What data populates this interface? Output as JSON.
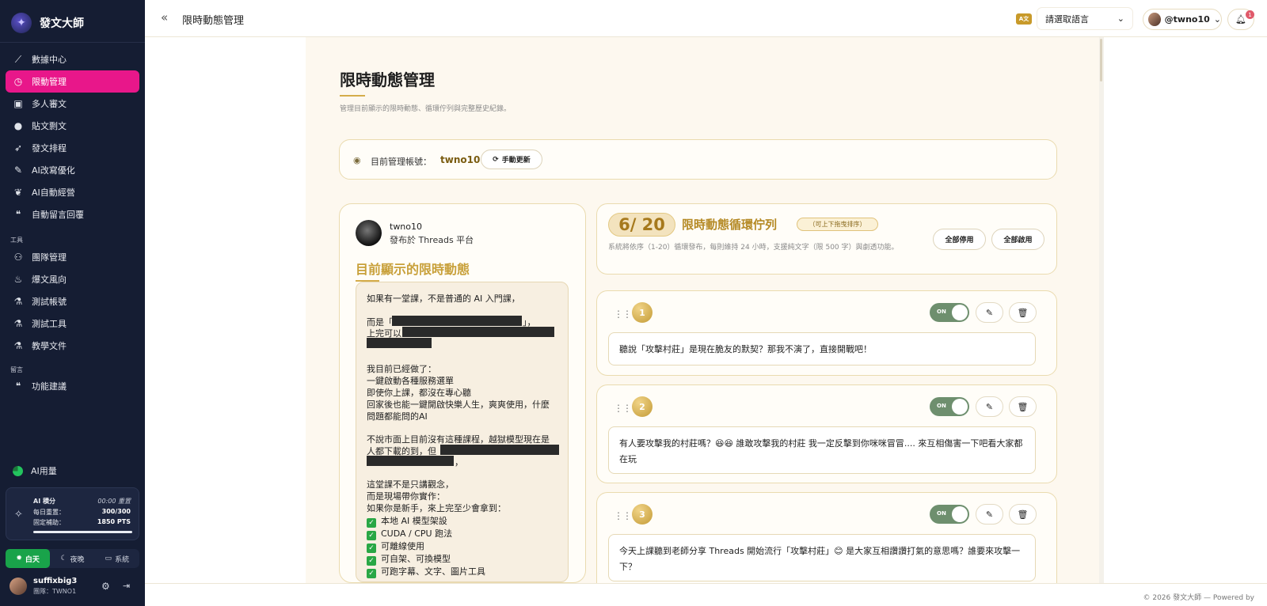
{
  "app": {
    "name": "發文大師"
  },
  "sidebar": {
    "items": [
      {
        "label": "數據中心",
        "icon": "chart-line-icon"
      },
      {
        "label": "限動管理",
        "icon": "clock-icon",
        "active": true
      },
      {
        "label": "多人審文",
        "icon": "calendar-check-icon"
      },
      {
        "label": "貼文剽文",
        "icon": "user-icon"
      },
      {
        "label": "發文排程",
        "icon": "rocket-icon"
      },
      {
        "label": "AI改寫優化",
        "icon": "pen-icon"
      },
      {
        "label": "AI自動經營",
        "icon": "seedling-icon"
      },
      {
        "label": "自動留言回覆",
        "icon": "comments-icon"
      }
    ],
    "tools_label": "工具",
    "tools": [
      {
        "label": "團隊管理",
        "icon": "users-icon"
      },
      {
        "label": "爆文風向",
        "icon": "fire-icon"
      },
      {
        "label": "測試帳號",
        "icon": "flask-vial-icon"
      },
      {
        "label": "測試工具",
        "icon": "flask-icon"
      },
      {
        "label": "教學文件",
        "icon": "flask-vial-icon"
      }
    ],
    "comments_label": "留言",
    "comments": [
      {
        "label": "功能建議",
        "icon": "comments-icon"
      }
    ],
    "ai_usage_label": "AI用量",
    "points": {
      "title": "AI 積分",
      "reset": "00:00 重置",
      "daily_label": "每日重置：",
      "daily_value": "300/300",
      "fixed_label": "固定補助：",
      "fixed_value": "1850 PTS",
      "daily_fraction": 1.0
    },
    "theme": {
      "light": "白天",
      "dark": "夜晚",
      "system": "系統"
    },
    "user": {
      "name": "suffixbig3",
      "team": "團隊：TWNO1"
    }
  },
  "topbar": {
    "title": "限時動態管理",
    "lang_icon": "A文",
    "lang_select": "請選取語言",
    "account": "@twno10",
    "notifications": "1"
  },
  "page": {
    "title": "限時動態管理",
    "subtitle": "管理目前顯示的限時動態、循環佇列與完整歷史紀錄。",
    "account_label": "目前管理帳號：",
    "account_value": "twno10",
    "refresh_label": "手動更新"
  },
  "current_story": {
    "username": "twno10",
    "platform": "發布於 Threads 平台",
    "heading": "目前顯示的限時動態",
    "lines": [
      "如果有一堂課，不是普通的 AI 入門課，",
      "而是「",
      "」，",
      "上完可以",
      "我目前已經做了：",
      "一鍵啟動各種服務選單",
      "即使你上課，都沒在專心聽",
      "回家後也能一鍵開啟快樂人生，爽爽使用，什麼",
      "問題都能問的AI",
      "不說市面上目前沒有這種課程，越獄模型現在是",
      "人都下載的到，但",
      "，",
      "這堂課不是只講觀念，",
      "而是現場帶你實作：",
      "如果你是新手，來上完至少會拿到："
    ],
    "checklist": [
      "本地 AI 模型架設",
      "CUDA / CPU 跑法",
      "可離線使用",
      "可自架、可換模型",
      "可跑字幕、文字、圖片工具"
    ]
  },
  "queue": {
    "count": "6/ 20",
    "title": "限時動態循環佇列",
    "tag": "（可上下拖曳排序）",
    "description": "系統將依序（1-20）循環發布，每則維持 24 小時，支援純文字（限 500 字）與劇透功能。",
    "disable_all": "全部停用",
    "enable_all": "全部啟用",
    "items": [
      {
        "index": "1",
        "toggle": "ON",
        "text": "聽說「攻擊村莊」是現在脆友的默契？那我不演了，直接開戰吧！"
      },
      {
        "index": "2",
        "toggle": "ON",
        "text": "有人要攻擊我的村莊嗎？😆😆 誰敢攻擊我的村莊 我一定反擊到你咪咪冒冒.... 來互相傷害一下吧看大家都在玩"
      },
      {
        "index": "3",
        "toggle": "ON",
        "text": "今天上課聽到老師分享 Threads 開始流行「攻擊村莊」😊 是大家互相讚讚打氣的意思嗎？誰要來攻擊一下？"
      }
    ]
  },
  "footer": {
    "text": "© 2026 發文大師 — Powered by"
  },
  "colors": {
    "accent": "#e8178a",
    "gold": "#c8a03a",
    "sidebar": "#151d33",
    "toggle_on": "#6e8f6e"
  }
}
